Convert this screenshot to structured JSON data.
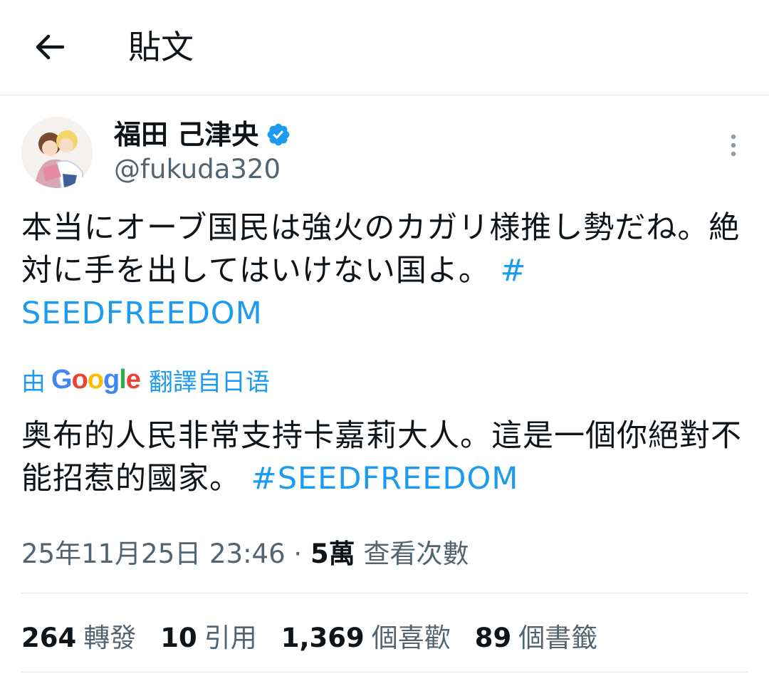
{
  "header": {
    "title": "貼文",
    "back_icon": "arrow-left-icon"
  },
  "author": {
    "display_name": "福田 己津央",
    "handle": "@fukuda320",
    "verified_icon": "verified-badge-icon",
    "verified_color": "#1d9bf0"
  },
  "tweet": {
    "text": "本当にオーブ国民は強火のカガリ様推し勢だね。絶対に手を出してはいけない国よ。",
    "hashtag_part1": "#",
    "hashtag_part2": "SEEDFREEDOM"
  },
  "translation": {
    "by": "由",
    "provider": "Google",
    "label": "翻譯自日语",
    "text": "奥布的人民非常支持卡嘉莉大人。這是一個你絕對不能招惹的國家。",
    "hashtag": "#SEEDFREEDOM"
  },
  "meta": {
    "timestamp": "25年11月25日 23:46",
    "separator": " · ",
    "views_count": "5萬",
    "views_label": "查看次數"
  },
  "stats": [
    {
      "count": "264",
      "label": "轉發"
    },
    {
      "count": "10",
      "label": "引用"
    },
    {
      "count": "1,369",
      "label": "個喜歡"
    },
    {
      "count": "89",
      "label": "個書籤"
    }
  ],
  "colors": {
    "accent": "#1d9bf0",
    "text_primary": "#0f1419",
    "text_secondary": "#536471",
    "divider": "#e7e7e7"
  }
}
